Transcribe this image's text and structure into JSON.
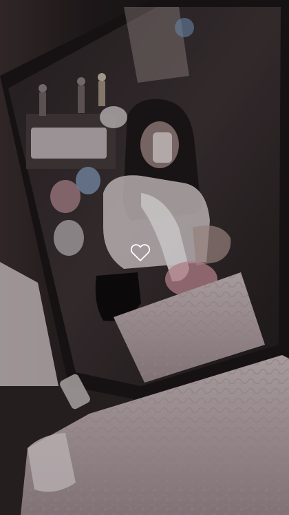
{
  "photo": {
    "subject": "mirror-selfie",
    "like_icon": "heart-outline-icon",
    "colors": {
      "shadow": "#120f10",
      "wall": "#2a2224",
      "mirror_frame": "#1b1718",
      "mirror_glass": "#3a3033",
      "bedding": "#c9b8bb",
      "bedding_dark": "#8f7f83",
      "heart_stroke": "#ffffff"
    }
  }
}
